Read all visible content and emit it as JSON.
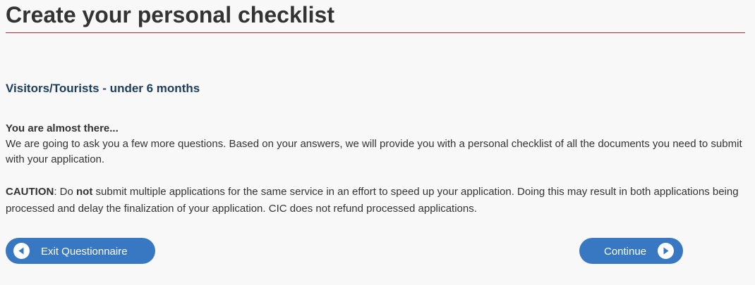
{
  "header": {
    "title": "Create your personal checklist"
  },
  "section": {
    "heading": "Visitors/Tourists - under 6 months"
  },
  "intro": {
    "heading": "You are almost there...",
    "body": "We are going to ask you a few more questions. Based on your answers, we will provide you with a personal checklist of all the documents you need to submit with your application."
  },
  "caution": {
    "label": "CAUTION",
    "text_part1": ": Do ",
    "emphasis": "not",
    "text_part2": " submit multiple applications for the same service in an effort to speed up your application.  Doing this may result in both applications being processed and delay the finalization of your application. CIC does not refund processed applications."
  },
  "buttons": {
    "exit_label": "Exit Questionnaire",
    "continue_label": "Continue"
  },
  "colors": {
    "title_rule": "#b0323a",
    "section_heading": "#1c3e5e",
    "button_bg": "#3878c2"
  },
  "icons": {
    "exit": "arrow-left-circle-icon",
    "continue": "arrow-right-circle-icon"
  }
}
